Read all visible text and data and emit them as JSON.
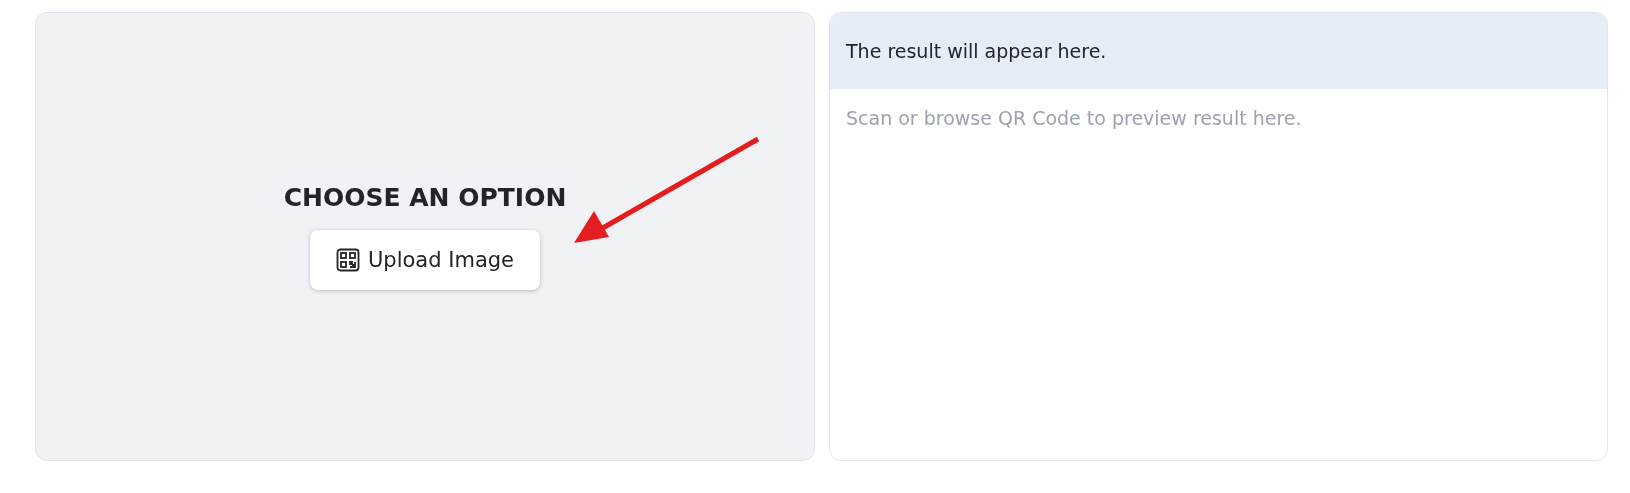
{
  "scanner": {
    "heading": "CHOOSE AN OPTION",
    "upload_button": "Upload Image"
  },
  "result": {
    "header": "The result will appear here.",
    "message": "Scan or browse QR Code to preview result here."
  }
}
